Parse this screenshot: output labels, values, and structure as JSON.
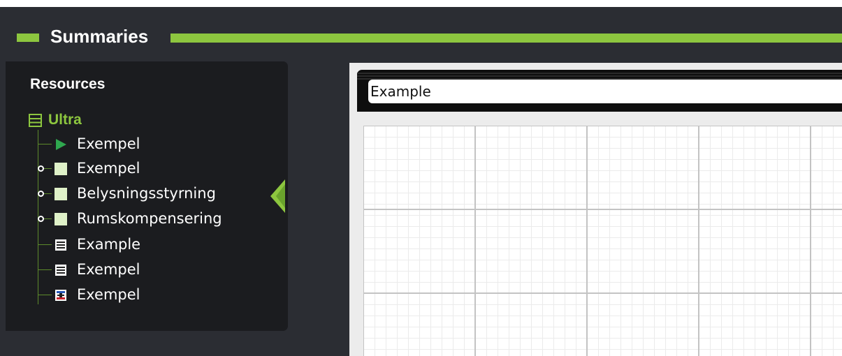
{
  "header": {
    "title": "Summaries",
    "accent_color": "#8dc63f"
  },
  "resources": {
    "title": "Resources",
    "root": {
      "label": "Ultra",
      "icon": "list-icon"
    },
    "items": [
      {
        "label": "Exempel",
        "icon": "play-icon",
        "expandable": false
      },
      {
        "label": "Exempel",
        "icon": "green-square-icon",
        "expandable": true
      },
      {
        "label": "Belysningsstyrning",
        "icon": "green-square-icon",
        "expandable": true
      },
      {
        "label": "Rumskompensering",
        "icon": "green-square-icon",
        "expandable": true
      },
      {
        "label": "Example",
        "icon": "list-icon",
        "expandable": false
      },
      {
        "label": "Exempel",
        "icon": "list-icon",
        "expandable": false
      },
      {
        "label": "Exempel",
        "icon": "component-icon",
        "expandable": false
      }
    ]
  },
  "collapse_panel": {
    "icon": "collapse-left-arrow-icon"
  },
  "editor": {
    "title_value": "Example"
  }
}
